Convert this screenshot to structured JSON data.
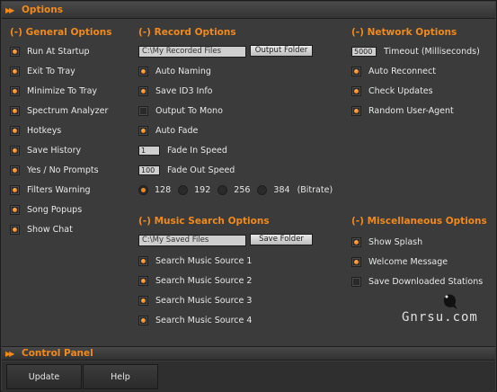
{
  "window": {
    "title": "Options"
  },
  "general": {
    "title": "(-) General Options",
    "items": [
      {
        "label": "Run At Startup",
        "checked": true
      },
      {
        "label": "Exit To Tray",
        "checked": true
      },
      {
        "label": "Minimize To Tray",
        "checked": true
      },
      {
        "label": "Spectrum Analyzer",
        "checked": true
      },
      {
        "label": "Hotkeys",
        "checked": true
      },
      {
        "label": "Save History",
        "checked": true
      },
      {
        "label": "Yes / No Prompts",
        "checked": true
      },
      {
        "label": "Filters Warning",
        "checked": true
      },
      {
        "label": "Song Popups",
        "checked": true
      },
      {
        "label": "Show Chat",
        "checked": true
      }
    ]
  },
  "record": {
    "title": "(-) Record Options",
    "path": "C:\\My Recorded Files",
    "output_button": "Output Folder",
    "auto_naming": "Auto Naming",
    "save_id3": "Save ID3 Info",
    "output_mono": "Output To Mono",
    "auto_fade": "Auto Fade",
    "fade_in_value": "1",
    "fade_in_label": "Fade In Speed",
    "fade_out_value": "100",
    "fade_out_label": "Fade Out Speed",
    "bitrates": [
      "128",
      "192",
      "256",
      "384"
    ],
    "selected_bitrate": "128",
    "bitrate_label": "(Bitrate)"
  },
  "network": {
    "title": "(-) Network Options",
    "timeout_value": "5000",
    "timeout_label": "Timeout (Milliseconds)",
    "auto_reconnect": "Auto Reconnect",
    "check_updates": "Check Updates",
    "random_ua": "Random User-Agent"
  },
  "music_search": {
    "title": "(-) Music Search Options",
    "path": "C:\\My Saved Files",
    "save_button": "Save Folder",
    "sources": [
      "Search Music Source 1",
      "Search Music Source 2",
      "Search Music Source 3",
      "Search Music Source 4"
    ]
  },
  "misc": {
    "title": "(-) Miscellaneous Options",
    "show_splash": "Show Splash",
    "welcome_message": "Welcome Message",
    "save_stations": "Save Downloaded Stations"
  },
  "watermark": "Gnrsu.com",
  "control_panel": {
    "title": "Control Panel",
    "update_button": "Update",
    "help_button": "Help"
  },
  "colors": {
    "accent": "#f08a1c",
    "background": "#3b3b3b"
  }
}
